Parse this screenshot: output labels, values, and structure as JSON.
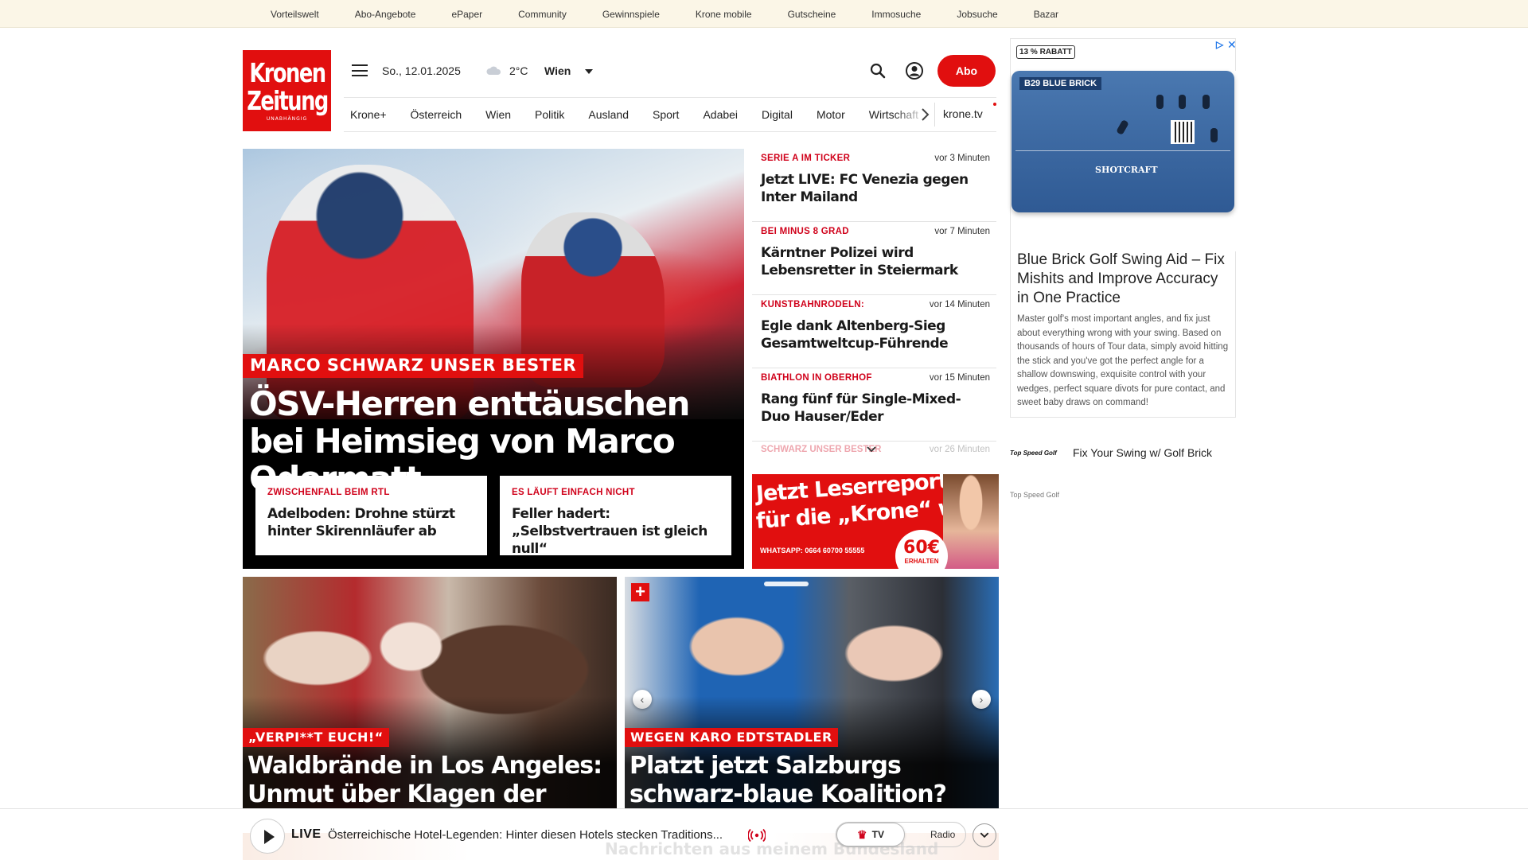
{
  "topbar": {
    "links": [
      "Vorteilswelt",
      "Abo-Angebote",
      "ePaper",
      "Community",
      "Gewinnspiele",
      "Krone mobile",
      "Gutscheine",
      "Immosuche",
      "Jobsuche",
      "Bazar"
    ]
  },
  "logo": {
    "line1": "Kronen",
    "line2": "Zeitung",
    "tagline": "UNABHÄNGIG"
  },
  "header": {
    "date": "So., 12.01.2025",
    "weather_icon": "cloud-icon",
    "temperature": "2°C",
    "city": "Wien",
    "abo_label": "Abo"
  },
  "nav": {
    "items": [
      "Krone+",
      "Österreich",
      "Wien",
      "Politik",
      "Ausland",
      "Sport",
      "Adabei",
      "Digital",
      "Motor",
      "Wirtschaft"
    ],
    "tv_label": "krone.tv"
  },
  "hero": {
    "kicker": "MARCO SCHWARZ UNSER BESTER",
    "title": "ÖSV-Herren enttäuschen bei Heimsieg von Marco Odermatt",
    "subs": [
      {
        "kicker": "ZWISCHENFALL BEIM RTL",
        "title": "Adelboden: Drohne stürzt hinter Skirennläufer ab"
      },
      {
        "kicker": "ES LÄUFT EINFACH NICHT",
        "title": "Feller hadert: „Selbstvertrauen ist gleich null“"
      }
    ]
  },
  "ticker": {
    "items": [
      {
        "kicker": "SERIE A IM TICKER",
        "time": "vor 3 Minuten",
        "title": "Jetzt LIVE: FC Venezia gegen Inter Mailand"
      },
      {
        "kicker": "BEI MINUS 8 GRAD",
        "time": "vor 7 Minuten",
        "title": "Kärntner Polizei wird Lebensretter in Steiermark"
      },
      {
        "kicker": "KUNSTBAHNRODELN:",
        "time": "vor 14 Minuten",
        "title": "Egle dank Altenberg-Sieg Gesamtweltcup-Führende"
      },
      {
        "kicker": "BIATHLON IN OBERHOF",
        "time": "vor 15 Minuten",
        "title": "Rang fünf für Single-Mixed-Duo Hauser/Eder"
      }
    ],
    "faded": {
      "kicker": "SCHWARZ UNSER BESTER",
      "time": "vor 26 Minuten"
    }
  },
  "leserreporter": {
    "line1": "Jetzt Leserreporter",
    "line2": "für die „Krone“ werden",
    "whatsapp": "WHATSAPP: 0664 60700 55555",
    "price": "60€",
    "price_sub": "ERHALTEN"
  },
  "cards": [
    {
      "kicker": "„VERPI**T EUCH!“",
      "title": "Waldbrände in Los Angeles: Unmut über Klagen der Promis"
    },
    {
      "kicker": "WEGEN KARO EDTSTADLER",
      "title": "Platzt jetzt Salzburgs schwarz-blaue Koalition?"
    }
  ],
  "ad": {
    "badge": "13 % RABATT",
    "product_label": "B29 BLUE BRICK",
    "product_brand": "SHOTCRAFT",
    "headline": "Blue Brick Golf Swing Aid – Fix Mishits and Improve Accuracy in One Practice",
    "body": "Master golf's most important angles, and fix just about everything wrong with your swing. Based on thousands of hours of Tour data, simply avoid hitting the stick and you've got the perfect angle for a shallow downswing, exquisite control with your wedges, perfect square divots for pure contact, and sweet baby draws on command!"
  },
  "text_ad": {
    "logo": "Top Speed Golf",
    "text": "Fix Your Swing w/ Golf Brick",
    "source": "Top Speed Golf"
  },
  "player": {
    "live_label": "LIVE",
    "title": "Österreichische Hotel-Legenden: Hinter diesen Hotels stecken Traditions...",
    "tv_label": "TV",
    "radio_label": "Radio",
    "background_text": "Nachrichten aus meinem Bundesland"
  },
  "colors": {
    "brand_red": "#e10f0f",
    "kicker_red": "#d0021b",
    "topbar_bg": "#fbf6e7"
  }
}
